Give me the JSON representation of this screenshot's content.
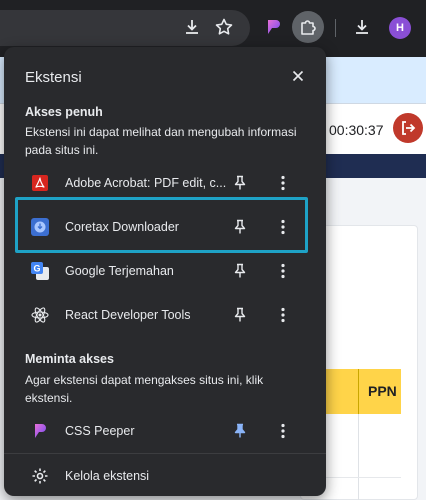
{
  "toolbar": {
    "avatar_initial": "H",
    "icons": [
      "download-icon",
      "bookmark-star-icon",
      "css-peeper-icon",
      "extensions-puzzle-icon",
      "download-icon",
      "profile-avatar"
    ]
  },
  "page": {
    "timer": "00:30:37",
    "table_header_ppn": "PPN"
  },
  "popup": {
    "title": "Ekstensi",
    "full_access": {
      "title": "Akses penuh",
      "description": "Ekstensi ini dapat melihat dan mengubah informasi pada situs ini.",
      "items": [
        {
          "name": "Adobe Acrobat: PDF edit, c...",
          "icon": "adobe-acrobat-icon",
          "pinned": false
        },
        {
          "name": "Coretax Downloader",
          "icon": "coretax-downloader-icon",
          "pinned": false
        },
        {
          "name": "Google Terjemahan",
          "icon": "google-translate-icon",
          "pinned": false
        },
        {
          "name": "React Developer Tools",
          "icon": "react-icon",
          "pinned": false
        }
      ]
    },
    "request_access": {
      "title": "Meminta akses",
      "description": "Agar ekstensi dapat mengakses situs ini, klik ekstensi.",
      "items": [
        {
          "name": "CSS Peeper",
          "icon": "css-peeper-icon",
          "pinned": true
        }
      ]
    },
    "manage_label": "Kelola ekstensi"
  },
  "colors": {
    "popup_bg": "#292a2d",
    "highlight": "#1ea2c6",
    "pinned_blue": "#8ab4f8",
    "table_header": "#ffd449",
    "logout_red": "#c0392b"
  }
}
